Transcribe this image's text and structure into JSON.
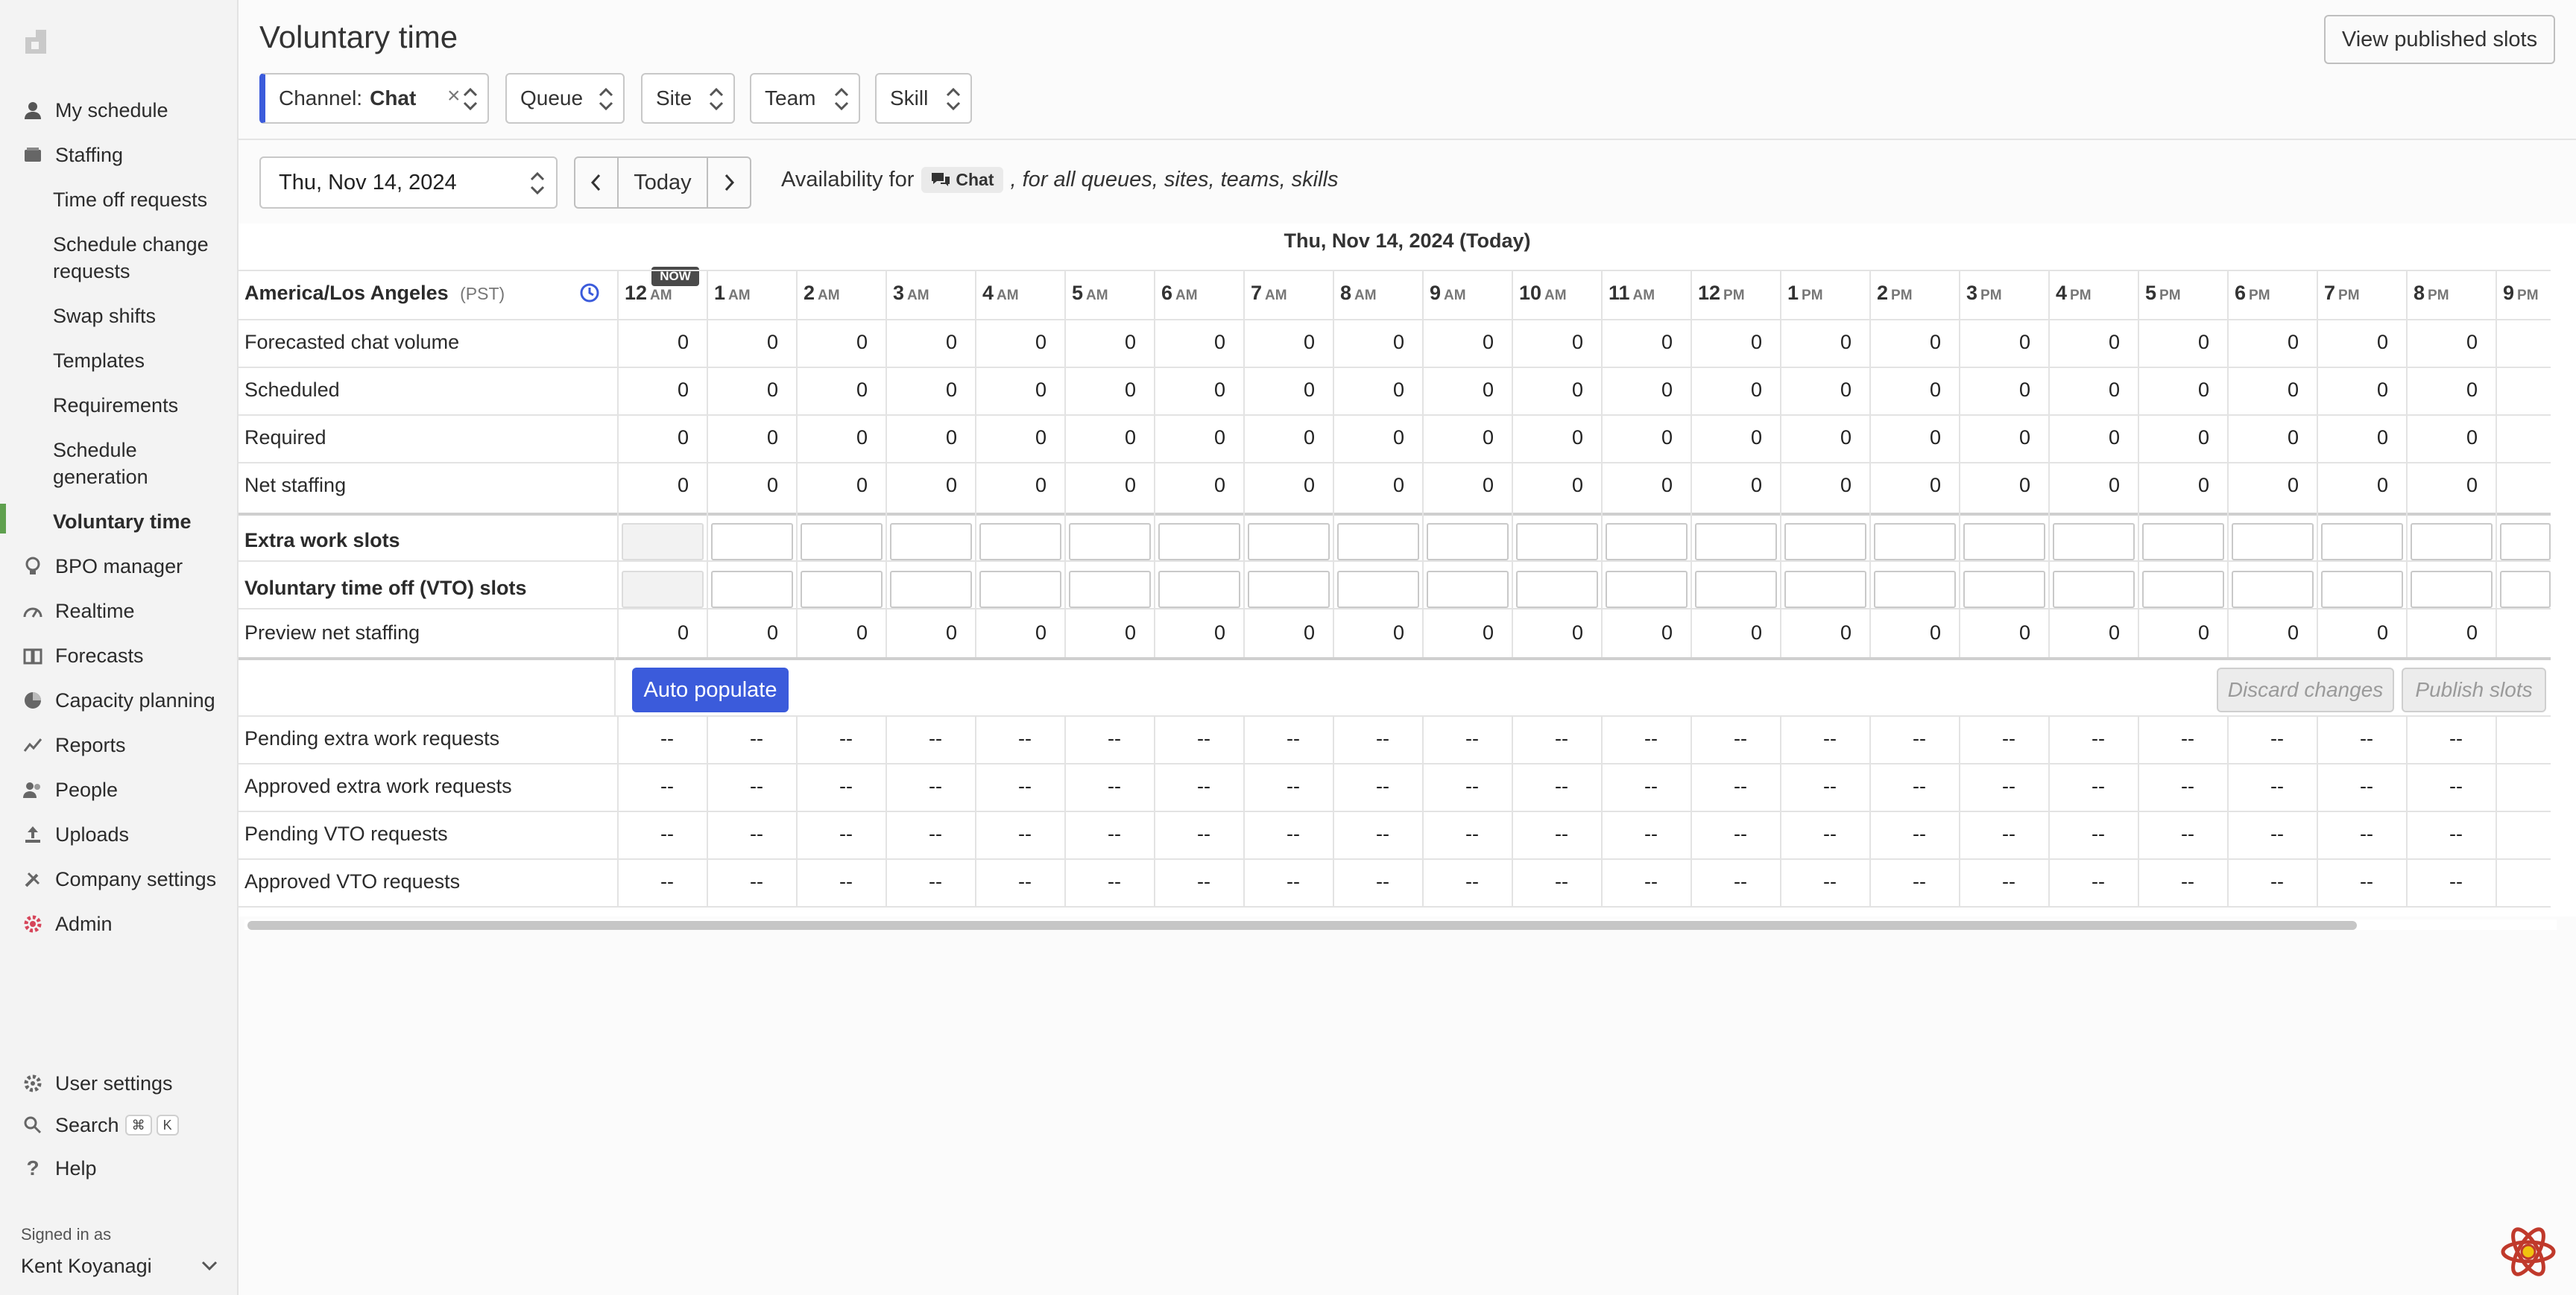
{
  "sidebar": {
    "items": [
      {
        "label": "My schedule",
        "icon": "user-icon"
      },
      {
        "label": "Staffing",
        "icon": "inbox-icon"
      },
      {
        "label": "BPO manager",
        "icon": "bulb-icon"
      },
      {
        "label": "Realtime",
        "icon": "gauge-icon"
      },
      {
        "label": "Forecasts",
        "icon": "book-icon"
      },
      {
        "label": "Capacity planning",
        "icon": "pie-icon"
      },
      {
        "label": "Reports",
        "icon": "trend-icon"
      },
      {
        "label": "People",
        "icon": "people-icon"
      },
      {
        "label": "Uploads",
        "icon": "upload-icon"
      },
      {
        "label": "Company settings",
        "icon": "tools-icon"
      },
      {
        "label": "Admin",
        "icon": "admin-gear-icon"
      }
    ],
    "staffing_sub": [
      "Time off requests",
      "Schedule change requests",
      "Swap shifts",
      "Templates",
      "Requirements",
      "Schedule generation",
      "Voluntary time"
    ],
    "user_settings": "User settings",
    "search": "Search",
    "search_kbd": [
      "⌘",
      "K"
    ],
    "help": "Help",
    "signed_in_label": "Signed in as",
    "signed_in_name": "Kent Koyanagi"
  },
  "header": {
    "title": "Voluntary time",
    "view_published": "View published slots"
  },
  "filters": {
    "channel_label": "Channel:",
    "channel_value": "Chat",
    "queue": "Queue",
    "site": "Site",
    "team": "Team",
    "skill": "Skill"
  },
  "controls": {
    "date": "Thu, Nov 14, 2024",
    "today": "Today",
    "availability_prefix": "Availability for",
    "availability_chip": "Chat",
    "availability_suffix": ", for all queues, sites, teams, skills"
  },
  "grid": {
    "date_heading": "Thu, Nov 14, 2024 (Today)",
    "timezone": "America/Los Angeles",
    "timezone_abbr": "(PST)",
    "now_badge": "NOW",
    "hours": [
      {
        "h": "12",
        "p": "AM"
      },
      {
        "h": "1",
        "p": "AM"
      },
      {
        "h": "2",
        "p": "AM"
      },
      {
        "h": "3",
        "p": "AM"
      },
      {
        "h": "4",
        "p": "AM"
      },
      {
        "h": "5",
        "p": "AM"
      },
      {
        "h": "6",
        "p": "AM"
      },
      {
        "h": "7",
        "p": "AM"
      },
      {
        "h": "8",
        "p": "AM"
      },
      {
        "h": "9",
        "p": "AM"
      },
      {
        "h": "10",
        "p": "AM"
      },
      {
        "h": "11",
        "p": "AM"
      },
      {
        "h": "12",
        "p": "PM"
      },
      {
        "h": "1",
        "p": "PM"
      },
      {
        "h": "2",
        "p": "PM"
      },
      {
        "h": "3",
        "p": "PM"
      },
      {
        "h": "4",
        "p": "PM"
      },
      {
        "h": "5",
        "p": "PM"
      },
      {
        "h": "6",
        "p": "PM"
      },
      {
        "h": "7",
        "p": "PM"
      },
      {
        "h": "8",
        "p": "PM"
      },
      {
        "h": "9",
        "p": "PM"
      }
    ],
    "value_rows": [
      {
        "label": "Forecasted chat volume",
        "value": "0"
      },
      {
        "label": "Scheduled",
        "value": "0"
      },
      {
        "label": "Required",
        "value": "0"
      },
      {
        "label": "Net staffing",
        "value": "0"
      }
    ],
    "slot_rows": [
      "Extra work slots",
      "Voluntary time off (VTO) slots"
    ],
    "preview_row": {
      "label": "Preview net staffing",
      "value": "0"
    },
    "request_rows": [
      {
        "label": "Pending extra work requests",
        "value": "--"
      },
      {
        "label": "Approved extra work requests",
        "value": "--"
      },
      {
        "label": "Pending VTO requests",
        "value": "--"
      },
      {
        "label": "Approved VTO requests",
        "value": "--"
      }
    ],
    "auto_populate": "Auto populate",
    "discard": "Discard changes",
    "publish": "Publish slots"
  },
  "colors": {
    "accent": "#3b5bdb",
    "active_bar": "#5fa04e",
    "admin_icon": "#d6455a"
  }
}
